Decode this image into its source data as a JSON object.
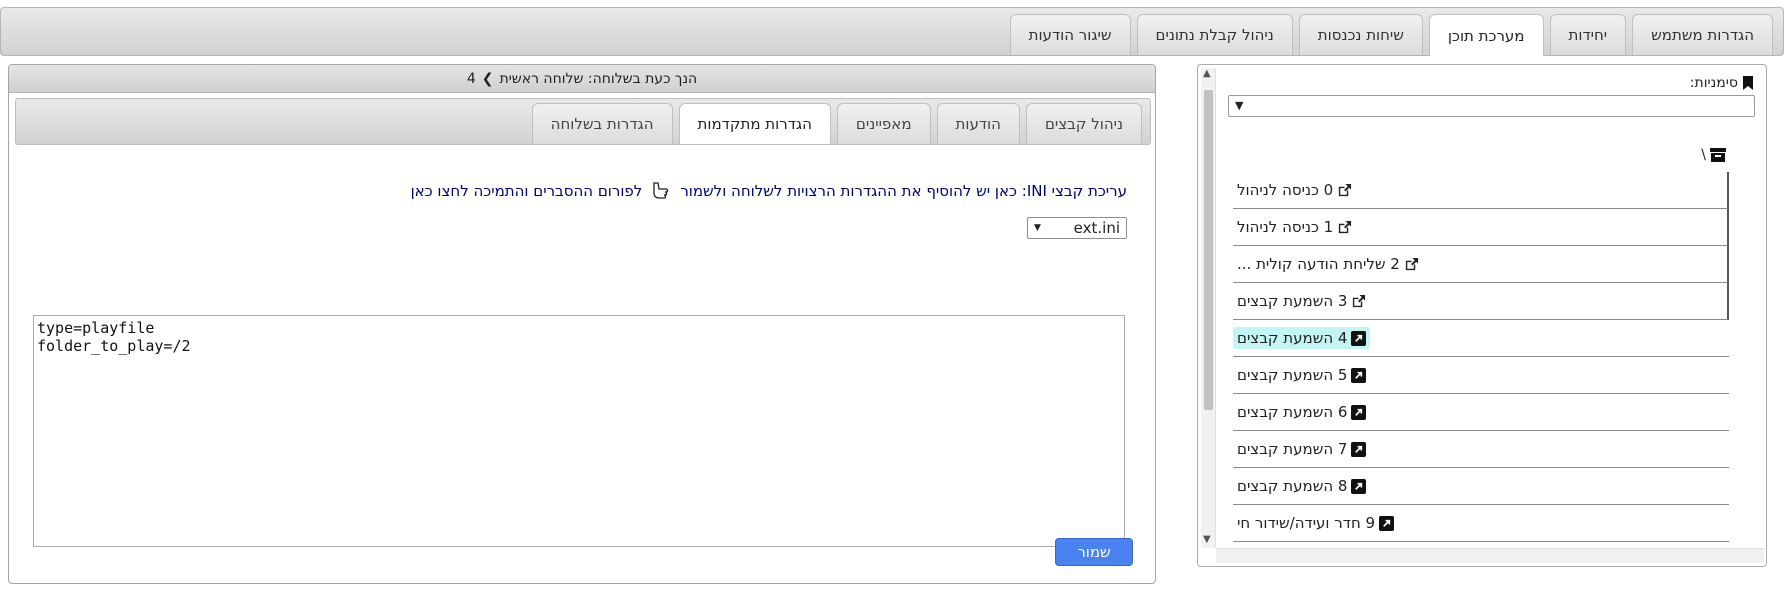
{
  "top_tabs": [
    {
      "label": "הגדרות משתמש"
    },
    {
      "label": "יחידות"
    },
    {
      "label": "מערכת תוכן",
      "active": true
    },
    {
      "label": "שיחות נכנסות"
    },
    {
      "label": "ניהול קבלת נתונים"
    },
    {
      "label": "שיגור הודעות"
    }
  ],
  "sidebar": {
    "bookmarks_label": "סימניות:",
    "bookmarks_select_value": "",
    "root_label": "\\",
    "items": [
      {
        "label": "0 כניסה לניהול",
        "icon": "external-link-icon"
      },
      {
        "label": "1 כניסה לניהול",
        "icon": "external-link-icon"
      },
      {
        "label": "2 שליחת הודעה קולית ...",
        "icon": "external-link-icon"
      },
      {
        "label": "3 השמעת קבצים",
        "icon": "external-link-icon"
      },
      {
        "label": "4 השמעת קבצים",
        "icon": "link-arrow-icon",
        "selected": true
      },
      {
        "label": "5 השמעת קבצים",
        "icon": "link-arrow-icon"
      },
      {
        "label": "6 השמעת קבצים",
        "icon": "link-arrow-icon"
      },
      {
        "label": "7 השמעת קבצים",
        "icon": "link-arrow-icon"
      },
      {
        "label": "8 השמעת קבצים",
        "icon": "link-arrow-icon"
      },
      {
        "label": "9 חדר ועידה/שידור חי",
        "icon": "link-arrow-icon"
      }
    ]
  },
  "main": {
    "header_prefix": "הנך כעת בשלוחה: שלוחה ראשית",
    "header_sep": "❯",
    "header_value": "4",
    "tabs": [
      {
        "label": "ניהול קבצים"
      },
      {
        "label": "הודעות"
      },
      {
        "label": "מאפיינים"
      },
      {
        "label": "הגדרות מתקדמות",
        "active": true
      },
      {
        "label": "הגדרות בשלוחה"
      }
    ],
    "help_text": "עריכת קבצי INI: כאן יש להוסיף את ההגדרות הרצויות לשלוחה ולשמור",
    "help_link": "לפורום ההסברים והתמיכה לחצו כאן",
    "file_select_value": "ext.ini",
    "editor_content": "type=playfile\nfolder_to_play=/2",
    "save_label": "שמור"
  },
  "colors": {
    "accent": "#4a82f0",
    "selected_bg": "#c4f4f4",
    "link": "#00007a"
  }
}
